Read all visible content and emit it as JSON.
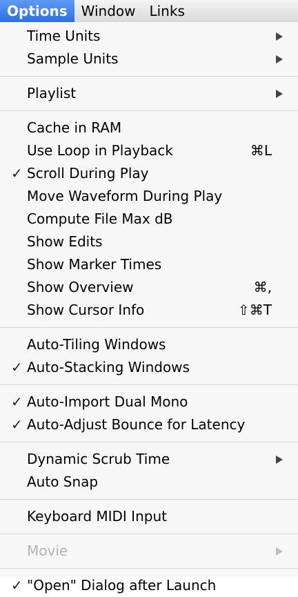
{
  "menubar": {
    "items": [
      "Options",
      "Window",
      "Links"
    ],
    "active_index": 0
  },
  "menu": {
    "items": [
      {
        "label": "Time Units",
        "submenu": true
      },
      {
        "label": "Sample Units",
        "submenu": true
      },
      {
        "separator": true
      },
      {
        "label": "Playlist",
        "submenu": true
      },
      {
        "separator": true
      },
      {
        "label": "Cache in RAM"
      },
      {
        "label": "Use Loop in Playback",
        "shortcut": "⌘L"
      },
      {
        "label": "Scroll During Play",
        "checked": true
      },
      {
        "label": "Move Waveform During Play"
      },
      {
        "label": "Compute File Max dB"
      },
      {
        "label": "Show Edits"
      },
      {
        "label": "Show Marker Times"
      },
      {
        "label": "Show Overview",
        "shortcut": "⌘,"
      },
      {
        "label": "Show Cursor Info",
        "shortcut": "⇧⌘T"
      },
      {
        "separator": true
      },
      {
        "label": "Auto-Tiling Windows"
      },
      {
        "label": "Auto-Stacking Windows",
        "checked": true
      },
      {
        "separator": true
      },
      {
        "label": "Auto-Import Dual Mono",
        "checked": true
      },
      {
        "label": "Auto-Adjust Bounce for Latency",
        "checked": true
      },
      {
        "separator": true
      },
      {
        "label": "Dynamic Scrub Time",
        "submenu": true
      },
      {
        "label": "Auto Snap"
      },
      {
        "separator": true
      },
      {
        "label": "Keyboard MIDI Input"
      },
      {
        "separator": true
      },
      {
        "label": "Movie",
        "submenu": true,
        "disabled": true
      },
      {
        "separator": true
      },
      {
        "label": "\"Open\" Dialog after Launch",
        "checked": true
      }
    ],
    "check_glyph": "✓"
  }
}
